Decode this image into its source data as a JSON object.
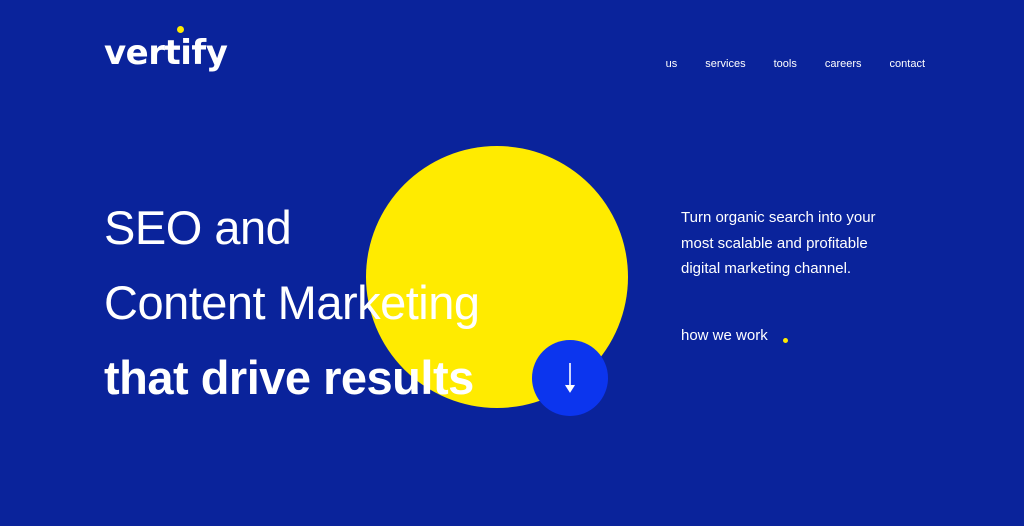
{
  "brand": {
    "name": "vertify",
    "accent_color": "#ffeb00",
    "background_color": "#0a239b",
    "button_color": "#0c35ee"
  },
  "nav": {
    "items": [
      {
        "label": "us"
      },
      {
        "label": "services"
      },
      {
        "label": "tools"
      },
      {
        "label": "careers"
      },
      {
        "label": "contact"
      }
    ]
  },
  "hero": {
    "headline_line1": "SEO and",
    "headline_line2": "Content Marketing",
    "headline_line3": "that drive results",
    "scroll_icon": "arrow-down-icon"
  },
  "side": {
    "tagline": "Turn organic search into your most scalable and profitable digital marketing channel.",
    "link_label": "how we work"
  }
}
